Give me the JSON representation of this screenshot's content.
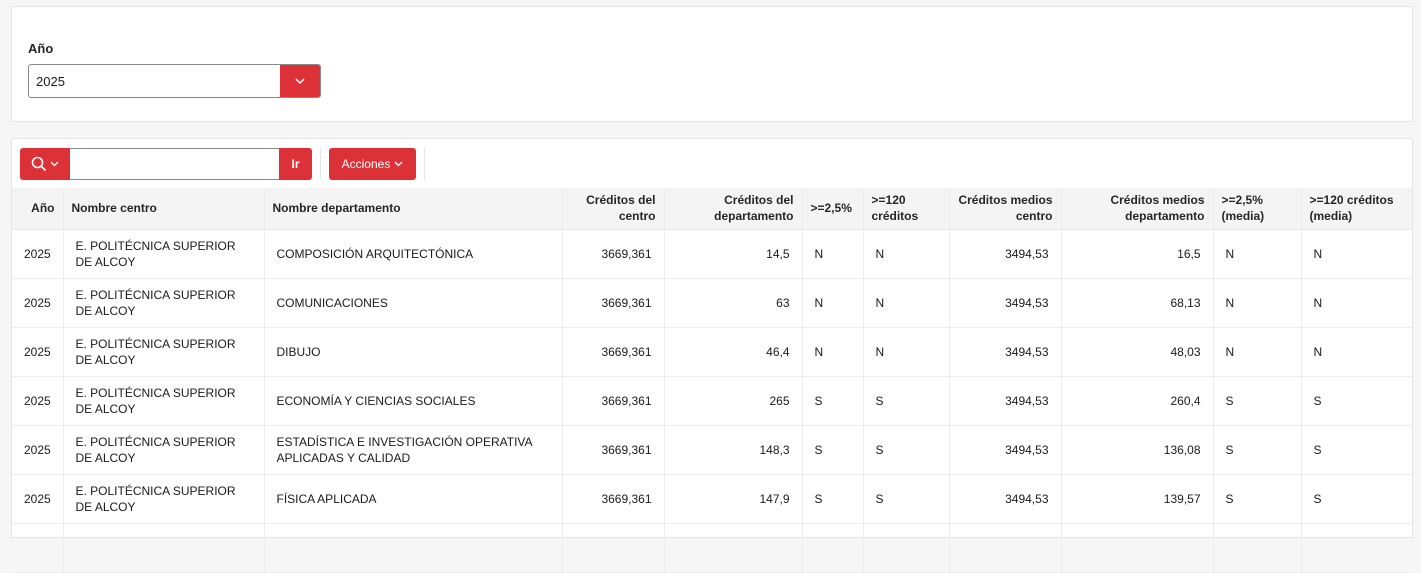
{
  "filter": {
    "year_label": "Año",
    "year_value": "2025"
  },
  "toolbar": {
    "search_value": "",
    "go_label": "Ir",
    "actions_label": "Acciones"
  },
  "colors": {
    "accent": "#dc3137"
  },
  "table": {
    "headers": {
      "anio": "Año",
      "centro": "Nombre centro",
      "departamento": "Nombre departamento",
      "creditos_centro": "Créditos del centro",
      "creditos_departamento": "Créditos del departamento",
      "pct": ">=2,5%",
      "ge120": ">=120 créditos",
      "medios_centro": "Créditos medios centro",
      "medios_departamento": "Créditos medios departamento",
      "pct_media": ">=2,5% (media)",
      "ge120_media": ">=120 créditos (media)"
    },
    "rows": [
      {
        "anio": "2025",
        "centro": "E. POLITÉCNICA SUPERIOR DE ALCOY",
        "departamento": "COMPOSICIÓN ARQUITECTÓNICA",
        "creditos_centro": "3669,361",
        "creditos_departamento": "14,5",
        "pct": "N",
        "ge120": "N",
        "medios_centro": "3494,53",
        "medios_departamento": "16,5",
        "pct_media": "N",
        "ge120_media": "N"
      },
      {
        "anio": "2025",
        "centro": "E. POLITÉCNICA SUPERIOR DE ALCOY",
        "departamento": "COMUNICACIONES",
        "creditos_centro": "3669,361",
        "creditos_departamento": "63",
        "pct": "N",
        "ge120": "N",
        "medios_centro": "3494,53",
        "medios_departamento": "68,13",
        "pct_media": "N",
        "ge120_media": "N"
      },
      {
        "anio": "2025",
        "centro": "E. POLITÉCNICA SUPERIOR DE ALCOY",
        "departamento": "DIBUJO",
        "creditos_centro": "3669,361",
        "creditos_departamento": "46,4",
        "pct": "N",
        "ge120": "N",
        "medios_centro": "3494,53",
        "medios_departamento": "48,03",
        "pct_media": "N",
        "ge120_media": "N"
      },
      {
        "anio": "2025",
        "centro": "E. POLITÉCNICA SUPERIOR DE ALCOY",
        "departamento": "ECONOMÍA Y CIENCIAS SOCIALES",
        "creditos_centro": "3669,361",
        "creditos_departamento": "265",
        "pct": "S",
        "ge120": "S",
        "medios_centro": "3494,53",
        "medios_departamento": "260,4",
        "pct_media": "S",
        "ge120_media": "S"
      },
      {
        "anio": "2025",
        "centro": "E. POLITÉCNICA SUPERIOR DE ALCOY",
        "departamento": "ESTADÍSTICA E INVESTIGACIÓN OPERATIVA APLICADAS Y CALIDAD",
        "creditos_centro": "3669,361",
        "creditos_departamento": "148,3",
        "pct": "S",
        "ge120": "S",
        "medios_centro": "3494,53",
        "medios_departamento": "136,08",
        "pct_media": "S",
        "ge120_media": "S"
      },
      {
        "anio": "2025",
        "centro": "E. POLITÉCNICA SUPERIOR DE ALCOY",
        "departamento": "FÍSICA APLICADA",
        "creditos_centro": "3669,361",
        "creditos_departamento": "147,9",
        "pct": "S",
        "ge120": "S",
        "medios_centro": "3494,53",
        "medios_departamento": "139,57",
        "pct_media": "S",
        "ge120_media": "S"
      }
    ]
  }
}
